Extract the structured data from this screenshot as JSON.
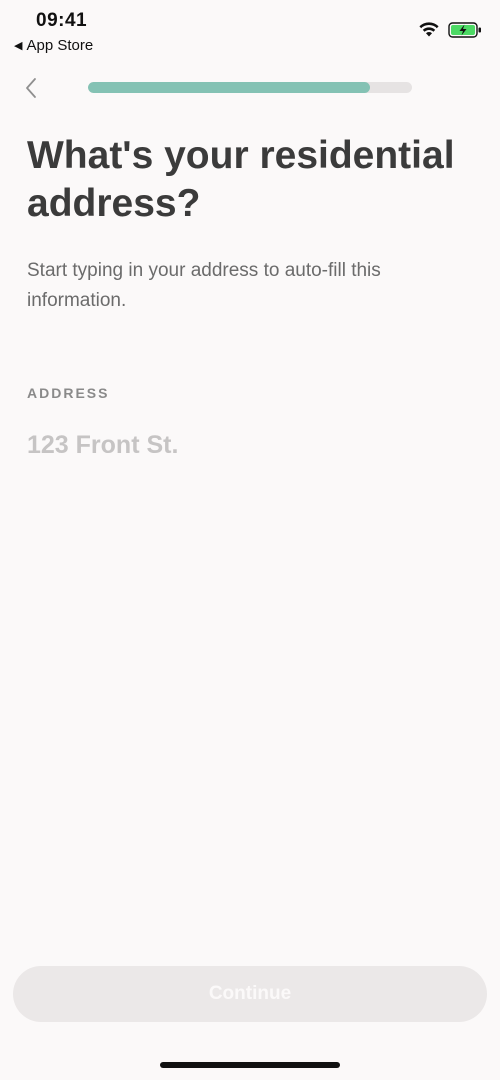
{
  "status_bar": {
    "time": "09:41",
    "back_label": "App Store",
    "back_glyph": "◀"
  },
  "nav": {
    "back_icon": "chevron-left-icon"
  },
  "progress": {
    "fraction": 0.87,
    "track_color": "#e6e3e3",
    "fill_color": "#84c2b4"
  },
  "page": {
    "title": "What's your residential address?",
    "subtitle": "Start typing in your address to auto-fill this information."
  },
  "address_field": {
    "label": "ADDRESS",
    "value": "",
    "placeholder": "123 Front St."
  },
  "continue_button": {
    "label": "Continue",
    "enabled": false
  }
}
